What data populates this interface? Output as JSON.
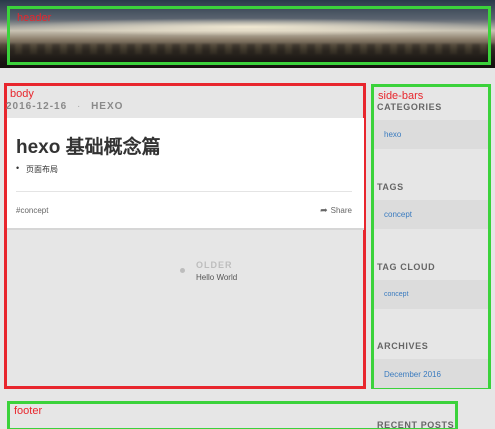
{
  "annotations": {
    "header": "header",
    "body": "body",
    "sidebars": "side-bars",
    "footer": "footer"
  },
  "post": {
    "date": "2016-12-16",
    "separator": "·",
    "category": "HEXO",
    "title": "hexo 基础概念篇",
    "list_items": [
      "页面布局"
    ],
    "tag": "#concept",
    "share_label": "Share"
  },
  "pagination": {
    "older_label": "OLDER",
    "older_title": "Hello World"
  },
  "sidebar": {
    "categories_heading": "CATEGORIES",
    "categories": [
      "hexo"
    ],
    "tags_heading": "TAGS",
    "tags": [
      "concept"
    ],
    "tag_cloud_heading": "TAG CLOUD",
    "tag_cloud": [
      "concept"
    ],
    "archives_heading": "ARCHIVES",
    "archives": [
      "December 2016"
    ],
    "recent_posts_heading": "RECENT POSTS"
  },
  "colors": {
    "annotation_green": "#3bd23b",
    "annotation_red": "#e8262d",
    "link": "#3a7bbf",
    "background": "#e6e6e6"
  },
  "icons": {
    "share": "share-arrow-icon",
    "older": "dot-icon"
  }
}
